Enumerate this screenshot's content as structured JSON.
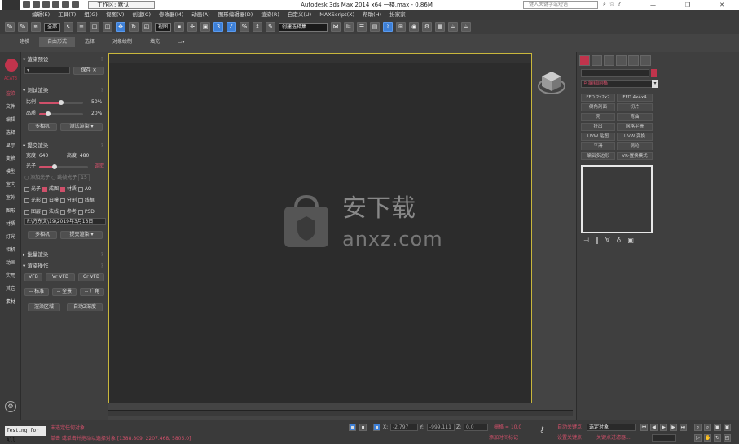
{
  "titlebar": {
    "workspace": "工作区: 默认",
    "app_title": "Autodesk 3ds Max  2014 x64      一楼.max - 0.86M",
    "search_placeholder": "键入关键字或短语",
    "minimize": "—",
    "maximize": "❐",
    "close": "✕"
  },
  "menu": [
    "编辑(E)",
    "工具(T)",
    "组(G)",
    "视图(V)",
    "创建(C)",
    "修改器(M)",
    "动画(A)",
    "图形编辑器(D)",
    "渲染(R)",
    "自定义(U)",
    "MAXScript(X)",
    "帮助(H)",
    "扮家家"
  ],
  "toolbar": {
    "selection_filter": "全部",
    "ref_coord": "视图",
    "named_selection": "创建选择集"
  },
  "ribbon_tabs": [
    "建模",
    "自由形式",
    "选择",
    "对象绘制",
    "填充"
  ],
  "ribbon_active": 1,
  "left_icons": {
    "brand": "ACAT3",
    "items": [
      "渲染",
      "文件",
      "编辑",
      "选择",
      "显示",
      "变换",
      "模型",
      "室内",
      "室外",
      "图形",
      "材质",
      "灯光",
      "相机",
      "动画",
      "实用",
      "其它",
      "素材"
    ],
    "active_index": 0
  },
  "render_panel": {
    "preset_section": "渲染预设",
    "save_button": "保存",
    "test_section": "测试渲染",
    "ratio_label": "比例",
    "ratio_value": "50%",
    "quality_label": "品质",
    "quality_value": "20%",
    "multi_camera": "多相机",
    "test_render": "测试渲染",
    "submit_section": "提交渲染",
    "width_label": "宽度",
    "width_value": "640",
    "height_label": "高度",
    "height_value": "480",
    "photon_label": "光子",
    "photon_action": "调取",
    "radio_add_photon": "添加光子",
    "radio_skip_photon": "跳帧光子",
    "photon_frames": "15",
    "checks_row1": [
      {
        "label": "光子",
        "on": false
      },
      {
        "label": "成图",
        "on": true
      },
      {
        "label": "材质",
        "on": true
      },
      {
        "label": "AO",
        "on": false
      }
    ],
    "checks_row2": [
      {
        "label": "光影",
        "on": false
      },
      {
        "label": "白模",
        "on": false
      },
      {
        "label": "分割",
        "on": false
      },
      {
        "label": "线框",
        "on": false
      }
    ],
    "checks_row3": [
      {
        "label": "图层",
        "on": false
      },
      {
        "label": "法线",
        "on": false
      },
      {
        "label": "参考",
        "on": false
      },
      {
        "label": "PSD",
        "on": false
      }
    ],
    "output_path": "F:\\方东文\\19\\2019年3月13日",
    "multi_camera2": "多相机",
    "submit_render": "提交渲染",
    "batch_section": "批量渲染",
    "ops_section": "渲染操作",
    "btn_vfb": "VFB",
    "btn_vr_vfb": "Vr VFB",
    "btn_cr_vfb": "Cr VFB",
    "btn_standard": "-- 标准",
    "btn_full": "-- 全景",
    "btn_wide": "-- 广角",
    "btn_region": "渲染区域",
    "btn_auto_depth": "自动Z深度"
  },
  "watermark": {
    "brand_text": "安下载",
    "url": "anxz.com"
  },
  "command_panel": {
    "object_type": "可编辑网格",
    "buttons": [
      [
        "FFD 2x2x2",
        "FFD 4x4x4"
      ],
      [
        "倒角剖面",
        "切片"
      ],
      [
        "壳",
        "弯曲"
      ],
      [
        "挤出",
        "网格平滑"
      ],
      [
        "UVW 贴图",
        "UVW 变换"
      ],
      [
        "平滑",
        "涡轮"
      ],
      [
        "编辑多边形",
        "VR-置换模式"
      ]
    ],
    "mod_icons": [
      "pin-icon",
      "stack-icon",
      "unique-icon",
      "remove-icon",
      "configure-icon"
    ]
  },
  "statusbar": {
    "maxscript": "Testing for All",
    "status_line1": "未选定任何对象",
    "status_line2": "单击 或单击并拖动以选择对象 [1388.809, 2207.468, 5805.0]",
    "x_label": "X:",
    "x_value": "-2.797",
    "y_label": "Y:",
    "y_value": "-999.111",
    "z_label": "Z:",
    "z_value": "0.0",
    "grid_label": "栅格 = 10.0",
    "add_time_tag": "添加时间标记",
    "auto_key": "自动关键点",
    "set_key": "设置关键点",
    "selected_object": "选定对象",
    "key_filters": "关键点过滤器..."
  },
  "colors": {
    "accent": "#c0344c",
    "viewport_border": "#c9b73c",
    "active_blue": "#3d7fd6"
  }
}
